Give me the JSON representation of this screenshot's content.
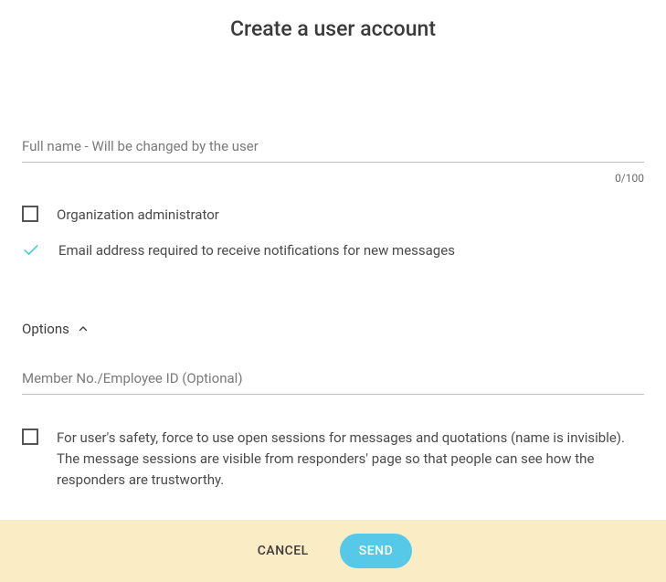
{
  "title": "Create a user account",
  "fullName": {
    "placeholder": "Full name - Will be changed by the user",
    "value": "",
    "counter": "0/100"
  },
  "checkboxes": {
    "orgAdmin": {
      "label": "Organization administrator",
      "checked": false
    },
    "emailRequired": {
      "label": "Email address required to receive notifications for new messages",
      "checked": true
    }
  },
  "optionsSection": {
    "header": "Options",
    "expanded": true
  },
  "memberNo": {
    "placeholder": "Member No./Employee ID (Optional)",
    "value": ""
  },
  "forceOpenSessions": {
    "label": "For user's safety, force to use open sessions for messages and quotations (name is invisible). The message sessions are visible from responders' page so that people can see how the responders are trustworthy.",
    "checked": false
  },
  "actions": {
    "cancel": "CANCEL",
    "send": "SEND"
  }
}
